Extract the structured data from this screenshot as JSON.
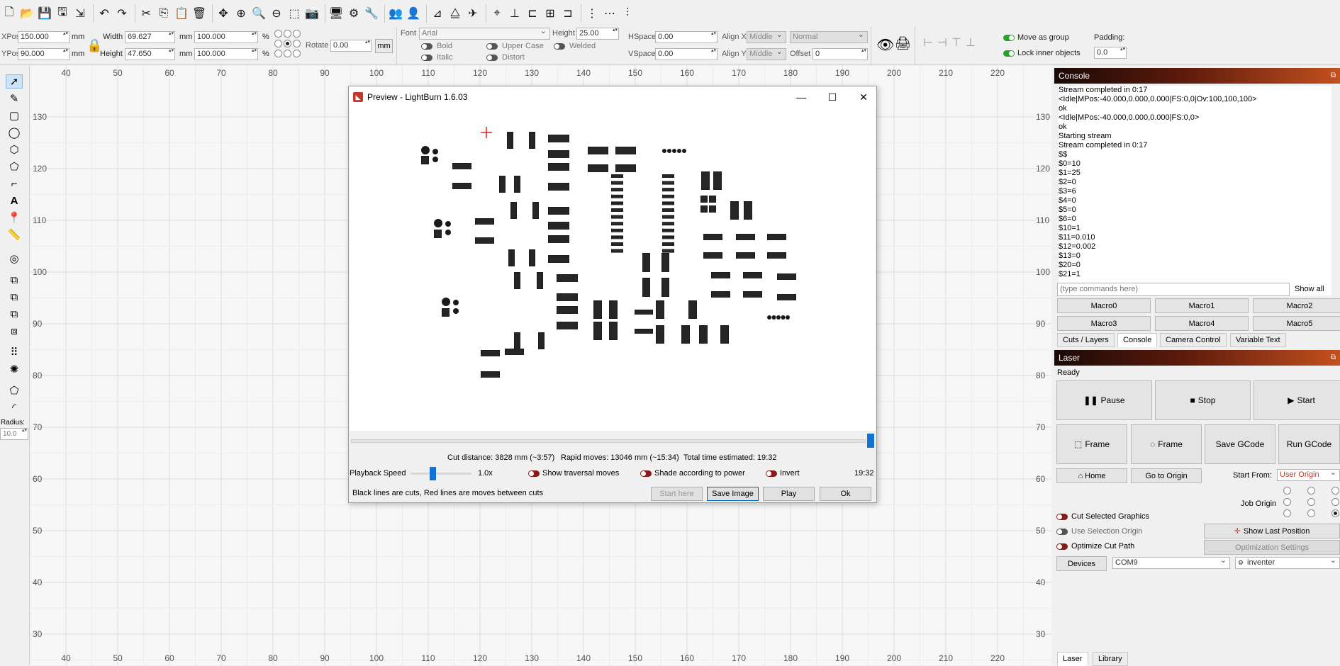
{
  "props": {
    "xpos_label": "XPos",
    "xpos": "150.000",
    "ypos_label": "YPos",
    "ypos": "90.000",
    "unit": "mm",
    "width_label": "Width",
    "width": "69.627",
    "height_label": "Height",
    "height": "47.650",
    "scale_w": "100.000",
    "scale_h": "100.000",
    "pct": "%",
    "rotate_label": "Rotate",
    "rotate": "0.00",
    "unit_btn": "mm",
    "font_label": "Font",
    "font_value": "Arial",
    "fheight_label": "Height",
    "fheight": "25.00",
    "bold": "Bold",
    "italic": "Italic",
    "upper_case": "Upper Case",
    "distort": "Distort",
    "welded": "Welded",
    "hspace_label": "HSpace",
    "hspace": "0.00",
    "vspace_label": "VSpace",
    "vspace": "0.00",
    "alignx_label": "Align X",
    "alignx": "Middle",
    "aligny_label": "Align Y",
    "aligny": "Middle",
    "normal": "Normal",
    "offset_label": "Offset",
    "offset": "0",
    "move_as_group": "Move as group",
    "lock_inner": "Lock inner objects",
    "padding_label": "Padding:",
    "padding": "0.0"
  },
  "left_tools": {
    "radius_label": "Radius:",
    "radius": "10.0"
  },
  "ruler": {
    "x_labels": [
      "40",
      "50",
      "60",
      "70",
      "80",
      "90",
      "100",
      "110",
      "120",
      "130",
      "140",
      "150",
      "160",
      "170",
      "180",
      "190",
      "200",
      "210",
      "220"
    ],
    "y_labels": [
      "130",
      "120",
      "110",
      "100",
      "90",
      "80",
      "70",
      "60",
      "50",
      "40",
      "30"
    ]
  },
  "preview": {
    "title": "Preview - LightBurn 1.6.03",
    "cut_distance": "Cut distance: 3828 mm (~3:57)",
    "rapid_moves": "Rapid moves: 13046 mm (~15:34)",
    "total_time": "Total time estimated: 19:32",
    "playback_label": "Playback Speed",
    "speed": "1.0x",
    "show_traversal": "Show traversal moves",
    "shade_power": "Shade according to power",
    "invert": "Invert",
    "time": "19:32",
    "legend": "Black lines are cuts, Red lines are moves between cuts",
    "start_here": "Start here",
    "save_image": "Save Image",
    "play": "Play",
    "ok": "Ok"
  },
  "console": {
    "title": "Console",
    "lines": [
      "Stream completed in 0:17",
      "<Idle|MPos:-40.000,0.000,0.000|FS:0,0|Ov:100,100,100>",
      "ok",
      "<Idle|MPos:-40.000,0.000,0.000|FS:0,0>",
      "ok",
      "Starting stream",
      "Stream completed in 0:17",
      "$$",
      "$0=10",
      "$1=25",
      "$2=0",
      "$3=6",
      "$4=0",
      "$5=0",
      "$6=0",
      "$10=1",
      "$11=0.010",
      "$12=0.002",
      "$13=0",
      "$20=0",
      "$21=1"
    ],
    "cmd_placeholder": "(type commands here)",
    "show_all": "Show all",
    "macros": [
      "Macro0",
      "Macro1",
      "Macro2",
      "Macro3",
      "Macro4",
      "Macro5"
    ],
    "tabs": [
      "Cuts / Layers",
      "Console",
      "Camera Control",
      "Variable Text"
    ]
  },
  "laser": {
    "title": "Laser",
    "status": "Ready",
    "pause": "Pause",
    "stop": "Stop",
    "start": "Start",
    "frame1": "Frame",
    "frame2": "Frame",
    "save_gcode": "Save GCode",
    "run_gcode": "Run GCode",
    "home": "Home",
    "go_origin": "Go to Origin",
    "start_from_label": "Start From:",
    "start_from": "User Origin",
    "job_origin": "Job Origin",
    "cut_selected": "Cut Selected Graphics",
    "use_selection_origin": "Use Selection Origin",
    "optimize_cut": "Optimize Cut Path",
    "show_last_position": "Show Last Position",
    "optimization_settings": "Optimization Settings",
    "devices": "Devices",
    "port": "COM9",
    "device_name": "inventer",
    "bottom_tabs": [
      "Laser",
      "Library"
    ]
  },
  "colors": {
    "accent": "#c4501e",
    "canvas_bg": "#f7f7f7",
    "cut": "#1a1a1a",
    "traversal_marker": "#e02020"
  }
}
